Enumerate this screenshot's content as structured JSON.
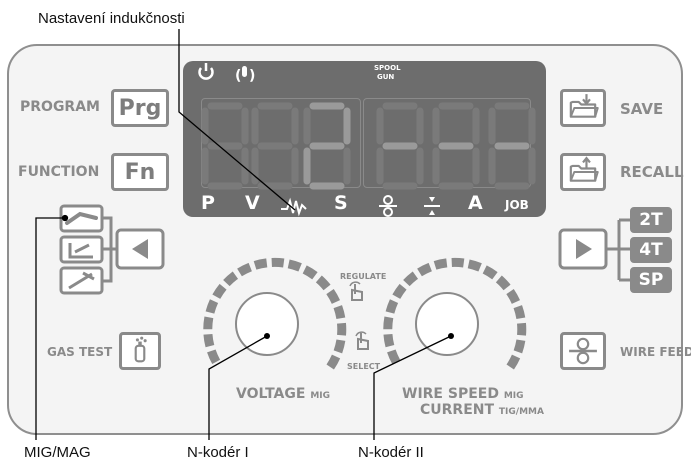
{
  "callouts": {
    "inductance": "Nastavení indukčnosti",
    "mig_mag": "MIG/MAG",
    "encoder_1": "N-kodér I",
    "encoder_2": "N-kodér II"
  },
  "left_keys": {
    "program_label": "PROGRAM",
    "program_key": "Prg",
    "function_label": "FUNCTION",
    "function_key": "Fn",
    "gas_test_label": "GAS TEST"
  },
  "right_keys": {
    "save_label": "SAVE",
    "recall_label": "RECALL",
    "wire_feed_label": "WIRE FEED",
    "trigger_modes": [
      "2T",
      "4T",
      "SP"
    ]
  },
  "display": {
    "top_icons": [
      "power-icon",
      "thermal-icon"
    ],
    "spool_gun": [
      "SPOOL",
      "GUN"
    ],
    "left_digits": "8 8 2",
    "right_digits": "- - -",
    "indicators": [
      "P",
      "V",
      "inductance-icon",
      "S",
      "wire-feed-icon",
      "gap-icon",
      "A",
      "JOB"
    ]
  },
  "knobs": {
    "regulate": "REGULATE",
    "select": "SELECT",
    "voltage": "VOLTAGE",
    "voltage_mode": "MIG",
    "wire_speed": "WIRE SPEED",
    "wire_speed_mode": "MIG",
    "current": "CURRENT",
    "current_mode": "TIG/MMA"
  },
  "colors": {
    "panel_fill": "#f4f4f4",
    "panel_border": "#8f8f8f",
    "display_fill": "#6d6d6d",
    "lit_segment": "#9a9a9a",
    "unlit_segment": "#7a7a7a",
    "key_gray": "#8a8a8a",
    "text_white": "#ffffff",
    "leader_line": "#000000"
  }
}
